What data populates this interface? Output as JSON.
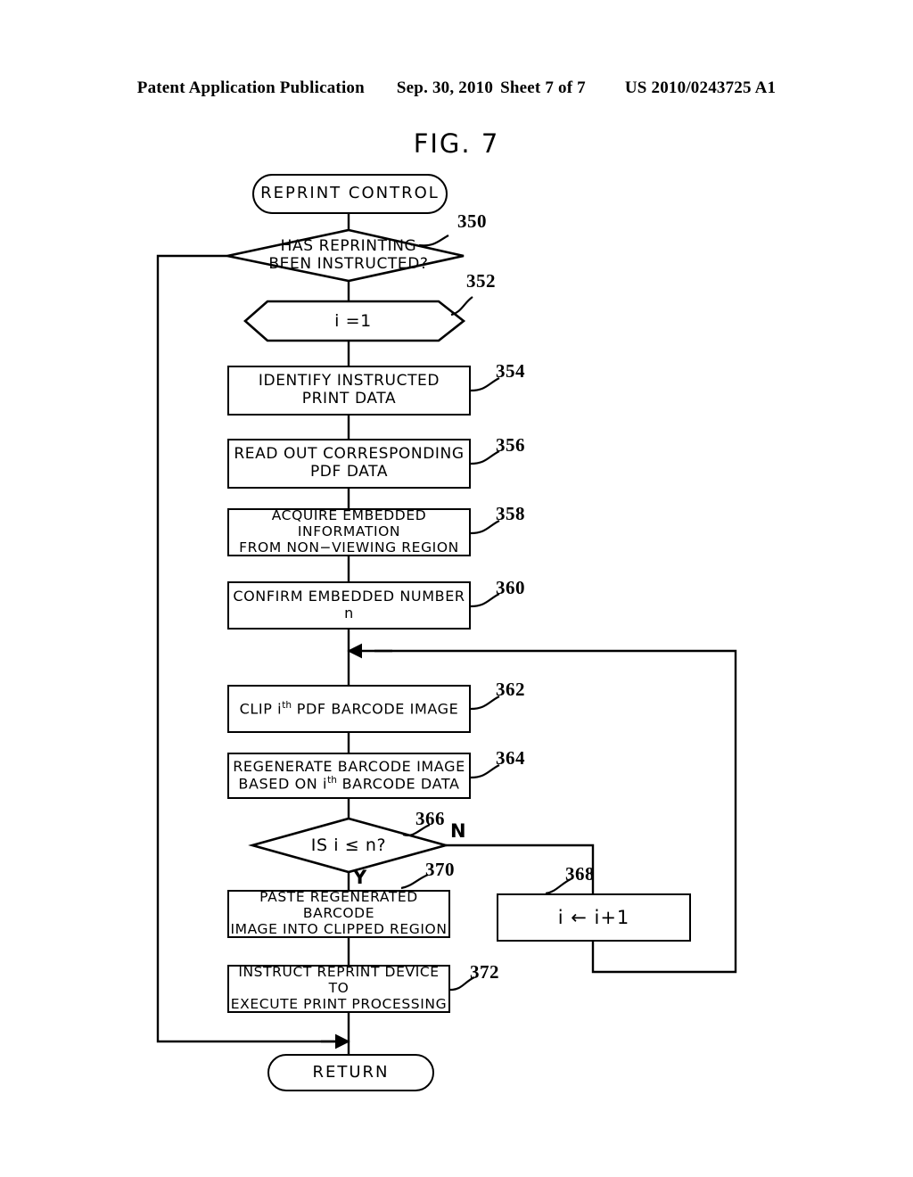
{
  "header": {
    "publication": "Patent Application Publication",
    "date": "Sep. 30, 2010",
    "sheet": "Sheet 7 of 7",
    "patent_number": "US 2010/0243725 A1"
  },
  "figure": {
    "title": "FIG. 7"
  },
  "flowchart": {
    "start_terminal": "REPRINT CONTROL",
    "end_terminal": "RETURN",
    "decision_350": "HAS REPRINTING\nBEEN INSTRUCTED?",
    "prep_352": "i =1",
    "box_354": "IDENTIFY INSTRUCTED\nPRINT DATA",
    "box_356": "READ OUT CORRESPONDING\nPDF DATA",
    "box_358": "ACQUIRE EMBEDDED INFORMATION\nFROM NON−VIEWING REGION",
    "box_360": "CONFIRM EMBEDDED NUMBER n",
    "box_362_pre": "CLIP i",
    "box_362_sup": "th",
    "box_362_post": " PDF BARCODE IMAGE",
    "box_364_line1": "REGENERATE BARCODE IMAGE",
    "box_364_pre": "BASED ON i",
    "box_364_sup": "th",
    "box_364_post": " BARCODE DATA",
    "decision_366": "IS i ≤ n?",
    "box_368": "i  ←  i+1",
    "box_370": "PASTE REGENERATED BARCODE\nIMAGE INTO CLIPPED REGION",
    "box_372": "INSTRUCT REPRINT DEVICE TO\nEXECUTE PRINT PROCESSING",
    "branch_yes": "Y",
    "branch_no": "N",
    "refs": {
      "r350": "350",
      "r352": "352",
      "r354": "354",
      "r356": "356",
      "r358": "358",
      "r360": "360",
      "r362": "362",
      "r364": "364",
      "r366": "366",
      "r368": "368",
      "r370": "370",
      "r372": "372"
    }
  },
  "colors": {
    "ink": "#000000",
    "paper": "#ffffff"
  }
}
